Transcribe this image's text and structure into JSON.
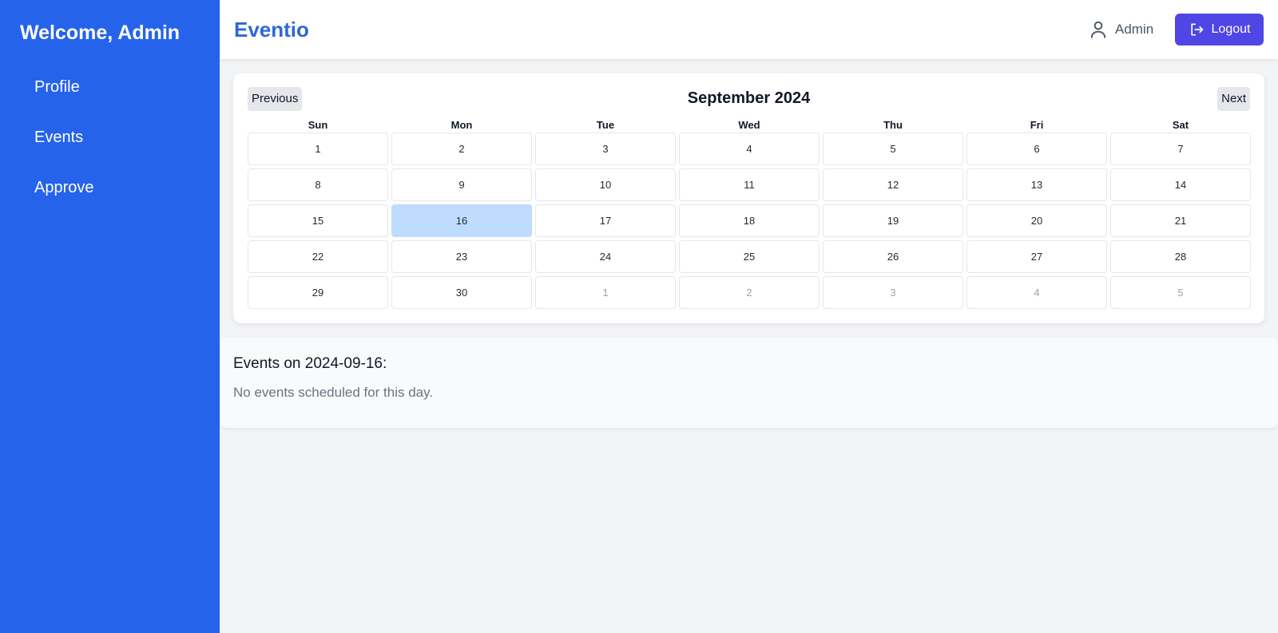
{
  "sidebar": {
    "title": "Welcome, Admin",
    "items": [
      {
        "label": "Profile"
      },
      {
        "label": "Events"
      },
      {
        "label": "Approve"
      }
    ]
  },
  "header": {
    "brand": "Eventio",
    "user_name": "Admin",
    "logout_label": "Logout"
  },
  "calendar": {
    "prev_label": "Previous",
    "next_label": "Next",
    "month_label": "September 2024",
    "weekdays": [
      "Sun",
      "Mon",
      "Tue",
      "Wed",
      "Thu",
      "Fri",
      "Sat"
    ],
    "days": [
      "1",
      "2",
      "3",
      "4",
      "5",
      "6",
      "7",
      "8",
      "9",
      "10",
      "11",
      "12",
      "13",
      "14",
      "15",
      "16",
      "17",
      "18",
      "19",
      "20",
      "21",
      "22",
      "23",
      "24",
      "25",
      "26",
      "27",
      "28",
      "29",
      "30",
      "1",
      "2",
      "3",
      "4",
      "5"
    ],
    "selected_day": "16",
    "trailing_other_month_days": 5
  },
  "events": {
    "title": "Events on 2024-09-16:",
    "empty_message": "No events scheduled for this day."
  },
  "colors": {
    "sidebar": "#2563eb",
    "brand": "#2f67d8",
    "logout": "#4f46e5",
    "selected_day": "#bfdbfe"
  },
  "icons": {
    "user": "user-icon",
    "logout": "logout-icon"
  }
}
